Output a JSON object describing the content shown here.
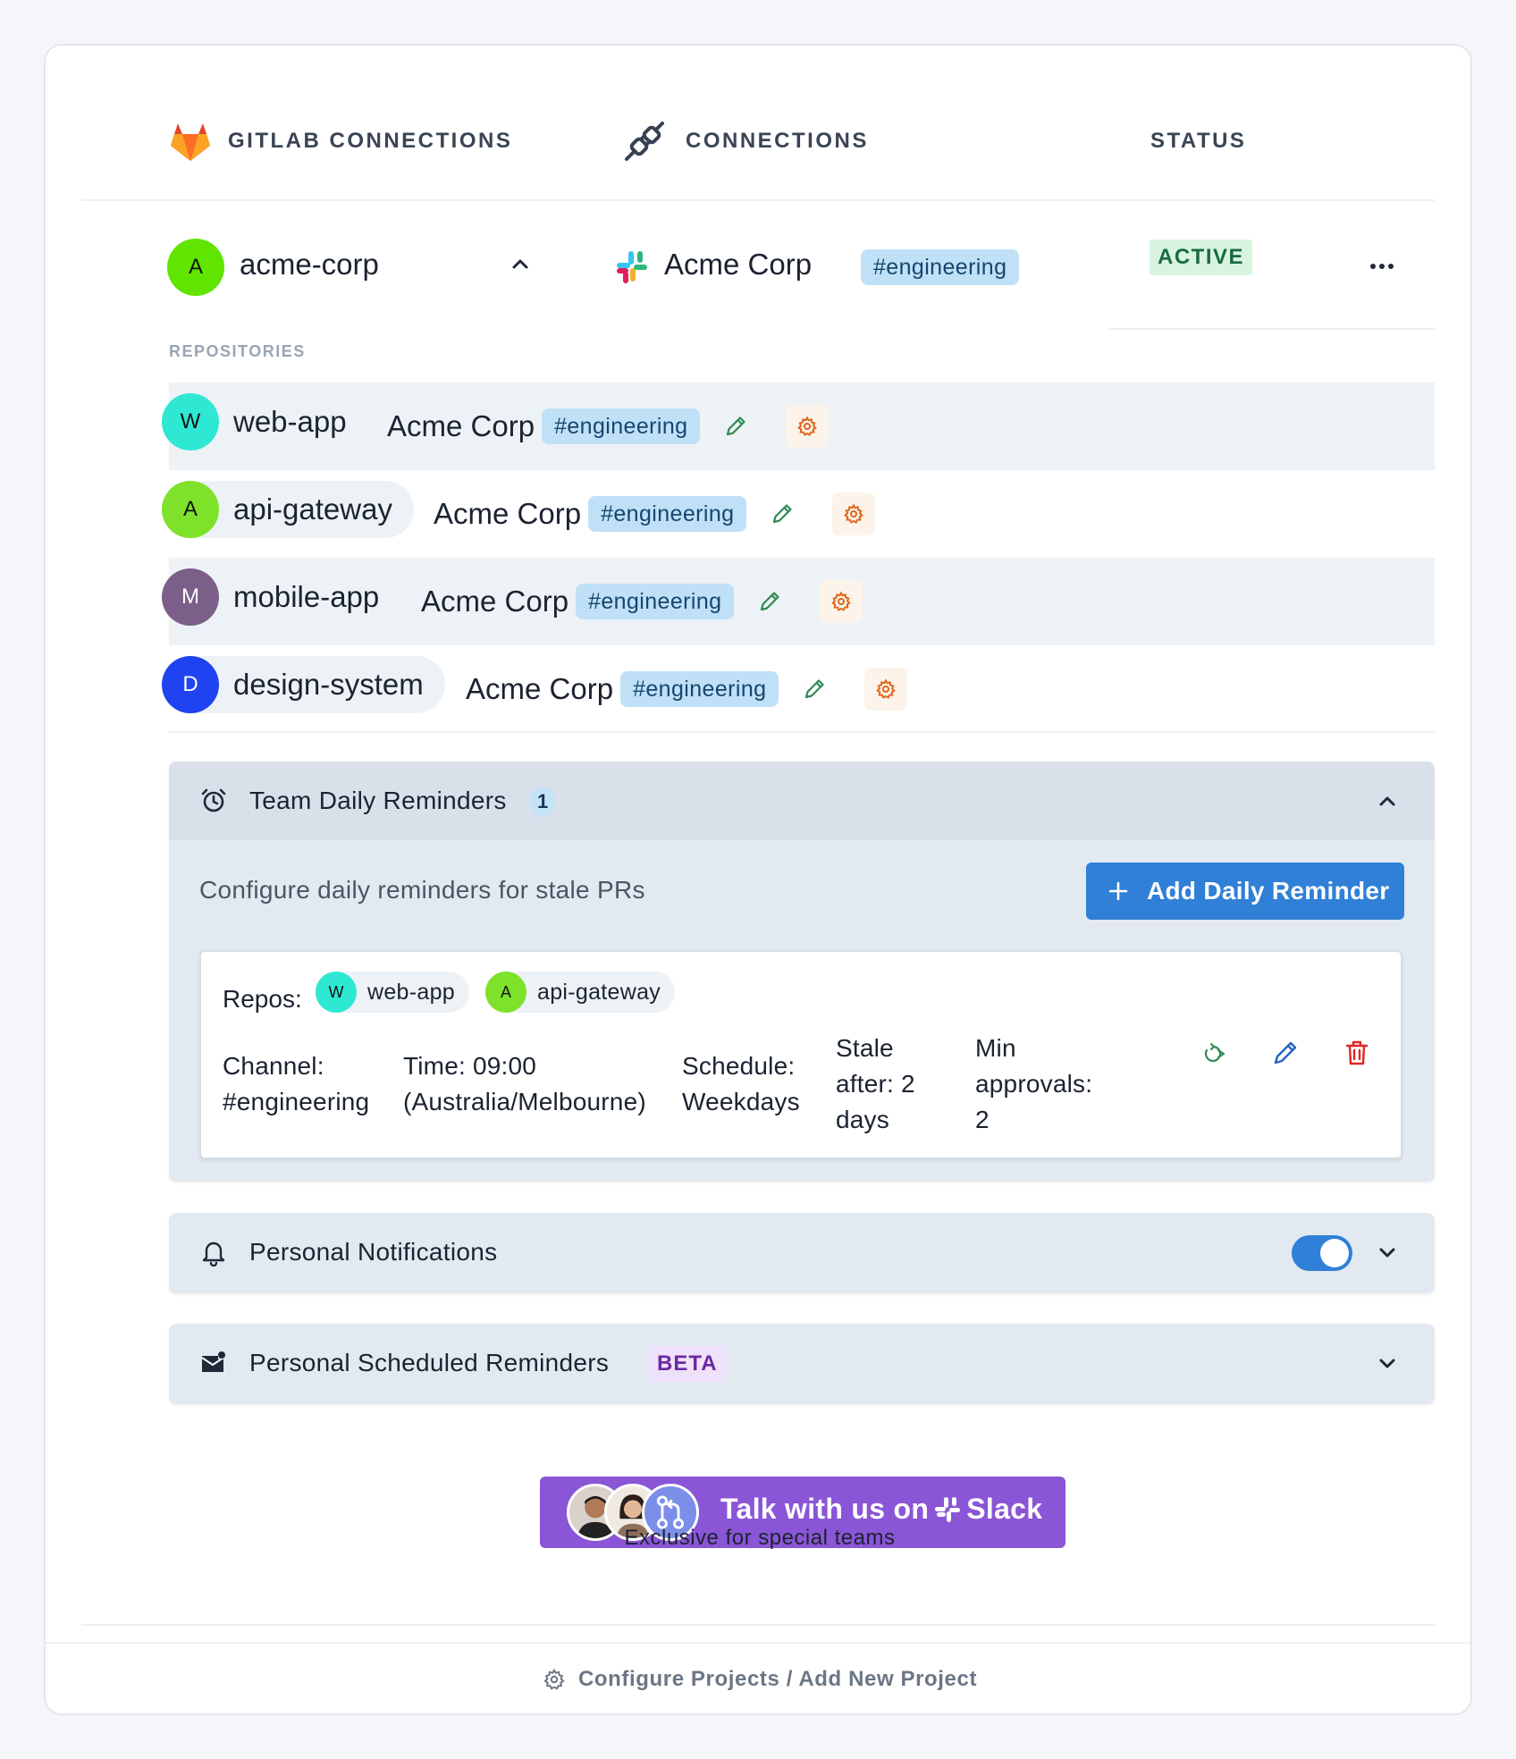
{
  "header": {
    "gitlab_label": "GITLAB CONNECTIONS",
    "connections_label": "CONNECTIONS",
    "status_label": "STATUS"
  },
  "org": {
    "avatar_letter": "A",
    "name": "acme-corp",
    "workspace": "Acme Corp",
    "channel": "#engineering",
    "status": "ACTIVE",
    "more_label": "•••"
  },
  "repositories_title": "REPOSITORIES",
  "repositories": [
    {
      "letter": "W",
      "name": "web-app",
      "workspace": "Acme Corp",
      "channel": "#engineering",
      "color": "#2ee8d4"
    },
    {
      "letter": "A",
      "name": "api-gateway",
      "workspace": "Acme Corp",
      "channel": "#engineering",
      "color": "#7ee22a"
    },
    {
      "letter": "M",
      "name": "mobile-app",
      "workspace": "Acme Corp",
      "channel": "#engineering",
      "color": "#7b5f88"
    },
    {
      "letter": "D",
      "name": "design-system",
      "workspace": "Acme Corp",
      "channel": "#engineering",
      "color": "#1f43f0"
    }
  ],
  "team_reminders": {
    "title": "Team Daily Reminders",
    "count": "1",
    "description": "Configure daily reminders for stale PRs",
    "add_button": "Add Daily Reminder",
    "reminder": {
      "repos_label": "Repos:",
      "repos": [
        {
          "letter": "W",
          "name": "web-app",
          "color": "#2ee8d4"
        },
        {
          "letter": "A",
          "name": "api-gateway",
          "color": "#7ee22a"
        }
      ],
      "channel_label": "Channel:",
      "channel_value": "#engineering",
      "time_label": "Time:",
      "time_value": "09:00",
      "time_zone": "(Australia/Melbourne)",
      "schedule_label": "Schedule:",
      "schedule_value": "Weekdays",
      "stale_line1": "Stale",
      "stale_line2": "after: 2",
      "stale_line3": "days",
      "min_line1": "Min",
      "min_line2": "approvals:",
      "min_line3": "2"
    }
  },
  "personal_notifications": {
    "title": "Personal Notifications",
    "enabled": true
  },
  "personal_scheduled": {
    "title": "Personal Scheduled Reminders",
    "badge": "BETA"
  },
  "cta": {
    "text_before": "Talk with us on",
    "text_after": "Slack",
    "subtitle": "Exclusive for special teams"
  },
  "footer": {
    "link": "Configure Projects / Add New Project"
  },
  "colors": {
    "accent": "#2f80d6",
    "cta": "#8a55d6",
    "active_bg": "#d8f4e1",
    "channel_pill": "#bfe0f6"
  }
}
